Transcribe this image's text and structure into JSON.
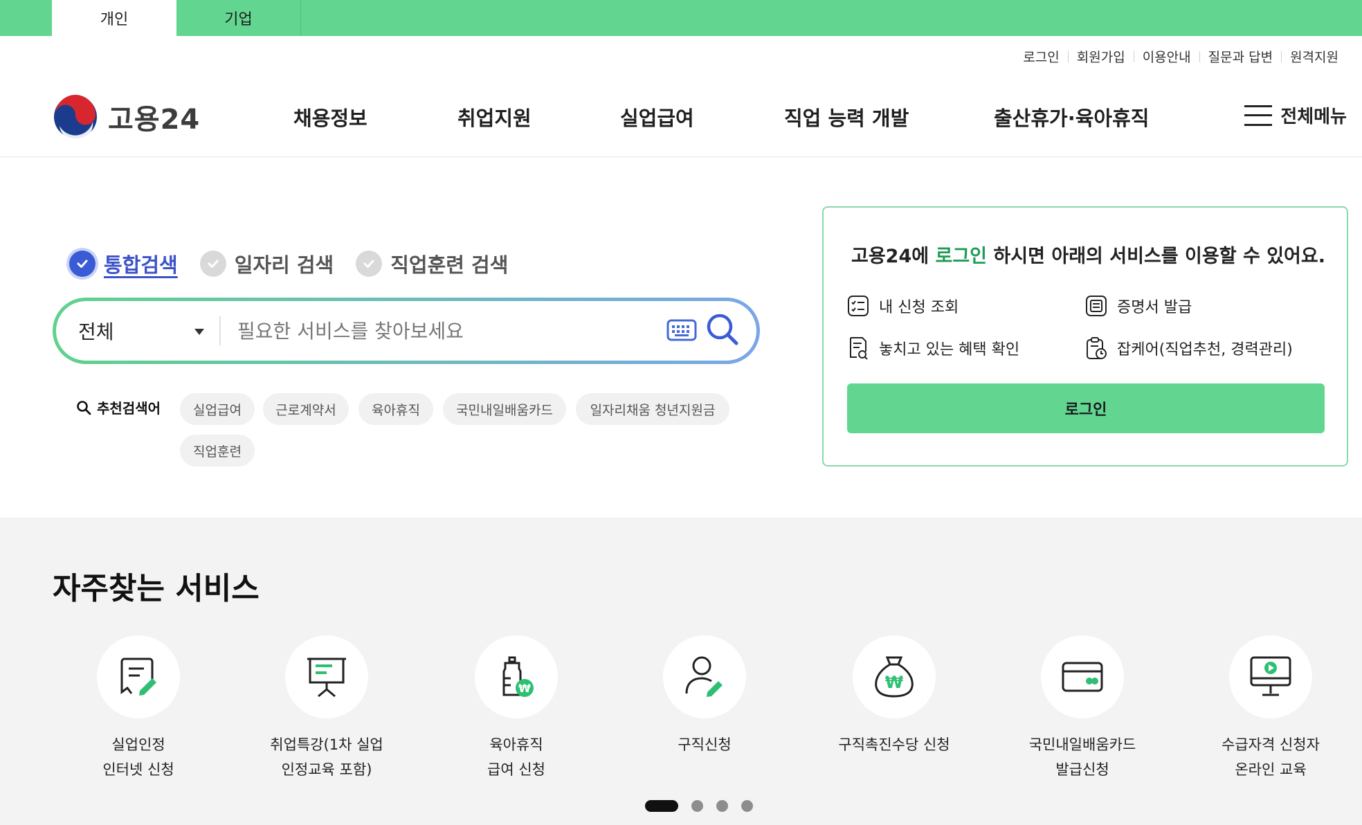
{
  "top_tabs": [
    {
      "label": "개인",
      "active": true
    },
    {
      "label": "기업",
      "active": false
    }
  ],
  "util_links": [
    "로그인",
    "회원가입",
    "이용안내",
    "질문과 답변",
    "원격지원"
  ],
  "logo": {
    "text": "고용24"
  },
  "gnb": [
    "채용정보",
    "취업지원",
    "실업급여",
    "직업 능력 개발",
    "출산휴가·육아휴직"
  ],
  "all_menu": "전체메뉴",
  "search": {
    "tabs": [
      {
        "label": "통합검색",
        "active": true
      },
      {
        "label": "일자리 검색",
        "active": false
      },
      {
        "label": "직업훈련 검색",
        "active": false
      }
    ],
    "select_value": "전체",
    "placeholder": "필요한 서비스를 찾아보세요",
    "recommend_title": "추천검색어",
    "keywords": [
      "실업급여",
      "근로계약서",
      "육아휴직",
      "국민내일배움카드",
      "일자리채움 청년지원금",
      "직업훈련"
    ]
  },
  "login_card": {
    "msg_prefix": "고용24에 ",
    "msg_highlight": "로그인",
    "msg_suffix": " 하시면 아래의 서비스를 이용할 수 있어요.",
    "services": [
      "내 신청 조회",
      "증명서 발급",
      "놓치고 있는 혜택 확인",
      "잡케어(직업추천, 경력관리)"
    ],
    "button": "로그인"
  },
  "frequent": {
    "title": "자주찾는 서비스",
    "items": [
      {
        "label": "실업인정\n인터넷 신청",
        "icon": "document-pen-icon"
      },
      {
        "label": "취업특강(1차 실업\n인정교육 포함)",
        "icon": "presentation-board-icon"
      },
      {
        "label": "육아휴직\n급여 신청",
        "icon": "baby-bottle-won-icon"
      },
      {
        "label": "구직신청",
        "icon": "person-pen-icon"
      },
      {
        "label": "구직촉진수당 신청",
        "icon": "money-bag-won-icon"
      },
      {
        "label": "국민내일배움카드\n발급신청",
        "icon": "card-icon"
      },
      {
        "label": "수급자격 신청자\n온라인 교육",
        "icon": "monitor-play-icon"
      }
    ]
  },
  "colors": {
    "brand_green": "#62d591",
    "accent_blue": "#3b5bd6",
    "highlight_green": "#1d9c55"
  }
}
